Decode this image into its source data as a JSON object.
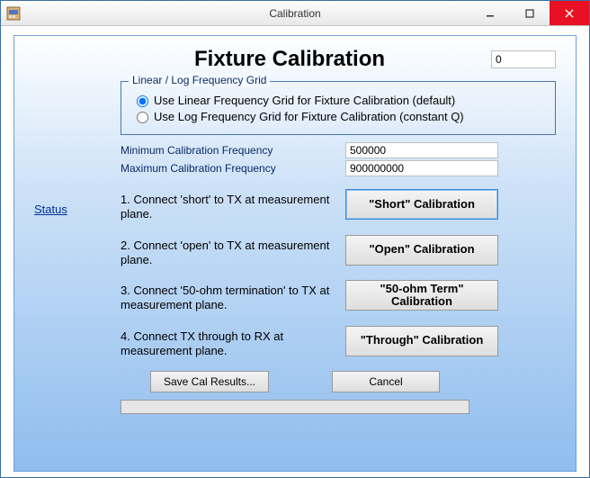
{
  "window": {
    "title": "Calibration"
  },
  "header": {
    "title": "Fixture Calibration",
    "value": "0"
  },
  "grid_group": {
    "legend": "Linear / Log Frequency Grid",
    "linear_label": "Use Linear Frequency Grid for Fixture Calibration (default)",
    "log_label": "Use Log Frequency Grid for Fixture Calibration (constant Q)",
    "selected": "linear"
  },
  "freq": {
    "min_label": "Minimum Calibration Frequency",
    "min_value": "500000",
    "max_label": "Maximum Calibration Frequency",
    "max_value": "900000000"
  },
  "status_label": "Status",
  "steps": [
    {
      "text": "1. Connect 'short' to TX at measurement plane.",
      "button": "\"Short\" Calibration"
    },
    {
      "text": "2. Connect 'open' to TX at measurement plane.",
      "button": "\"Open\" Calibration"
    },
    {
      "text": "3. Connect '50-ohm termination' to TX at measurement plane.",
      "button": "\"50-ohm Term\"\nCalibration"
    },
    {
      "text": "4. Connect TX through to RX at measurement plane.",
      "button": "\"Through\" Calibration"
    }
  ],
  "buttons": {
    "save": "Save Cal Results...",
    "cancel": "Cancel"
  }
}
